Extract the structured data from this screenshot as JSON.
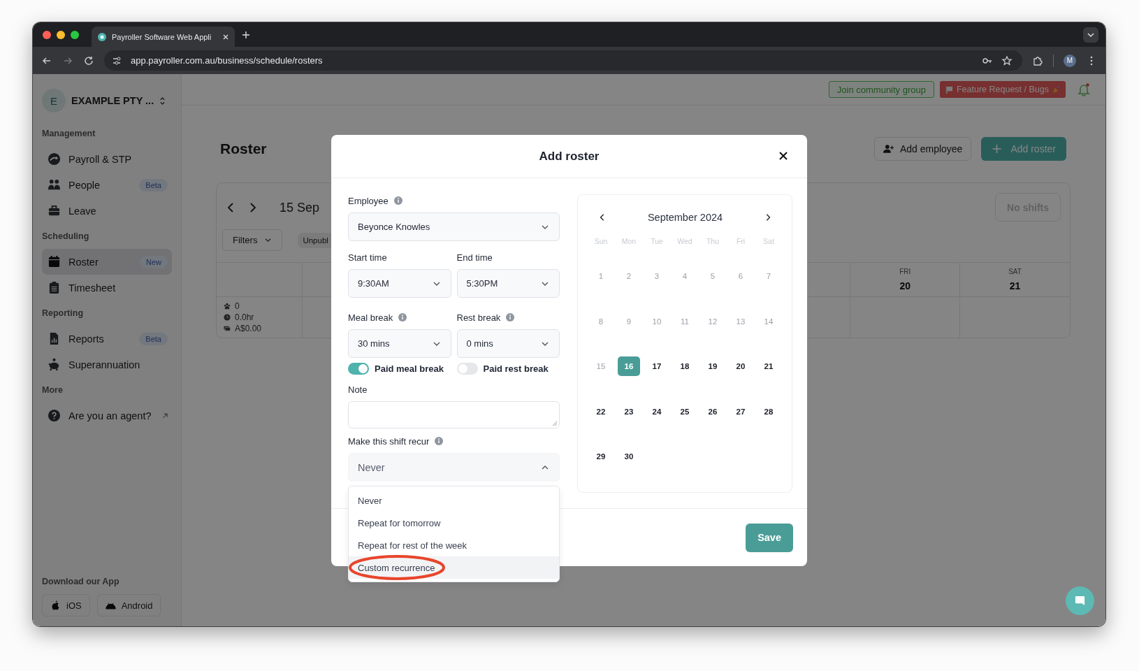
{
  "browser": {
    "tab_title": "Payroller Software Web Appli",
    "url": "app.payroller.com.au/business/schedule/rosters",
    "profile": "M"
  },
  "sidebar": {
    "org_initial": "E",
    "org_name": "EXAMPLE PTY ...",
    "sections": [
      {
        "title": "Management",
        "items": [
          {
            "label": "Payroll & STP",
            "kind": "payroll",
            "selected": false,
            "external": false
          },
          {
            "label": "People",
            "kind": "people",
            "badge": "Beta",
            "selected": false,
            "external": false
          },
          {
            "label": "Leave",
            "kind": "leave",
            "selected": false,
            "external": false
          }
        ]
      },
      {
        "title": "Scheduling",
        "items": [
          {
            "label": "Roster",
            "kind": "calendar",
            "badge": "New",
            "selected": true,
            "external": false
          },
          {
            "label": "Timesheet",
            "kind": "timesheet",
            "selected": false,
            "external": false
          }
        ]
      },
      {
        "title": "Reporting",
        "items": [
          {
            "label": "Reports",
            "kind": "reports",
            "badge": "Beta",
            "selected": false,
            "external": false
          },
          {
            "label": "Superannuation",
            "kind": "piggy",
            "selected": false,
            "external": false
          }
        ]
      },
      {
        "title": "More",
        "items": [
          {
            "label": "Are you an agent?",
            "kind": "help",
            "selected": false,
            "external": true
          }
        ]
      }
    ],
    "download_title": "Download our App",
    "apps": [
      {
        "label": "iOS",
        "kind": "apple"
      },
      {
        "label": "Android",
        "kind": "android"
      }
    ]
  },
  "header": {
    "community": "Join community group",
    "feature": "Feature Request / Bugs"
  },
  "roster": {
    "title": "Roster",
    "add_employee": "Add employee",
    "add_roster": "Add roster",
    "range": "15 Sep",
    "filters": "Filters",
    "status_chip": "Unpubl",
    "no_shifts": "No shifts",
    "days": [
      {
        "name": "FRI",
        "date": "20"
      },
      {
        "name": "SAT",
        "date": "21"
      }
    ],
    "stats": [
      {
        "kind": "people",
        "value": "0"
      },
      {
        "kind": "clock",
        "value": "0.0hr"
      },
      {
        "kind": "money",
        "value": "A$0.00"
      }
    ]
  },
  "modal": {
    "title": "Add roster",
    "employee": {
      "label": "Employee",
      "value": "Beyonce Knowles",
      "info": true
    },
    "start": {
      "label": "Start time",
      "value": "9:30AM",
      "info": false
    },
    "end": {
      "label": "End time",
      "value": "5:30PM",
      "info": false
    },
    "meal": {
      "label": "Meal break",
      "value": "30 mins",
      "info": true
    },
    "rest": {
      "label": "Rest break",
      "value": "0 mins",
      "info": true
    },
    "toggles": [
      {
        "label": "Paid meal break",
        "on": true
      },
      {
        "label": "Paid rest break",
        "on": false
      }
    ],
    "note": {
      "label": "Note"
    },
    "recur": {
      "label": "Make this shift recur",
      "value": "Never",
      "info": true,
      "expanded": true,
      "options": [
        {
          "label": "Never",
          "highlighted": false,
          "circled": false
        },
        {
          "label": "Repeat for tomorrow",
          "highlighted": false,
          "circled": false
        },
        {
          "label": "Repeat for rest of the week",
          "highlighted": false,
          "circled": false
        },
        {
          "label": "Custom recurrence",
          "highlighted": true,
          "circled": true
        }
      ]
    },
    "calendar": {
      "month": "September 2024",
      "weekdays": [
        "Sun",
        "Mon",
        "Tue",
        "Wed",
        "Thu",
        "Fri",
        "Sat"
      ],
      "days": [
        {
          "day": "1",
          "disabled": true,
          "selected": false
        },
        {
          "day": "2",
          "disabled": true,
          "selected": false
        },
        {
          "day": "3",
          "disabled": true,
          "selected": false
        },
        {
          "day": "4",
          "disabled": true,
          "selected": false
        },
        {
          "day": "5",
          "disabled": true,
          "selected": false
        },
        {
          "day": "6",
          "disabled": true,
          "selected": false
        },
        {
          "day": "7",
          "disabled": true,
          "selected": false
        },
        {
          "day": "8",
          "disabled": true,
          "selected": false
        },
        {
          "day": "9",
          "disabled": true,
          "selected": false
        },
        {
          "day": "10",
          "disabled": true,
          "selected": false
        },
        {
          "day": "11",
          "disabled": true,
          "selected": false
        },
        {
          "day": "12",
          "disabled": true,
          "selected": false
        },
        {
          "day": "13",
          "disabled": true,
          "selected": false
        },
        {
          "day": "14",
          "disabled": true,
          "selected": false
        },
        {
          "day": "15",
          "disabled": true,
          "selected": false
        },
        {
          "day": "16",
          "disabled": false,
          "selected": true
        },
        {
          "day": "17",
          "disabled": false,
          "selected": false
        },
        {
          "day": "18",
          "disabled": false,
          "selected": false
        },
        {
          "day": "19",
          "disabled": false,
          "selected": false
        },
        {
          "day": "20",
          "disabled": false,
          "selected": false
        },
        {
          "day": "21",
          "disabled": false,
          "selected": false
        },
        {
          "day": "22",
          "disabled": false,
          "selected": false
        },
        {
          "day": "23",
          "disabled": false,
          "selected": false
        },
        {
          "day": "24",
          "disabled": false,
          "selected": false
        },
        {
          "day": "25",
          "disabled": false,
          "selected": false
        },
        {
          "day": "26",
          "disabled": false,
          "selected": false
        },
        {
          "day": "27",
          "disabled": false,
          "selected": false
        },
        {
          "day": "28",
          "disabled": false,
          "selected": false
        },
        {
          "day": "29",
          "disabled": false,
          "selected": false
        },
        {
          "day": "30",
          "disabled": false,
          "selected": false
        }
      ]
    },
    "save": "Save"
  }
}
